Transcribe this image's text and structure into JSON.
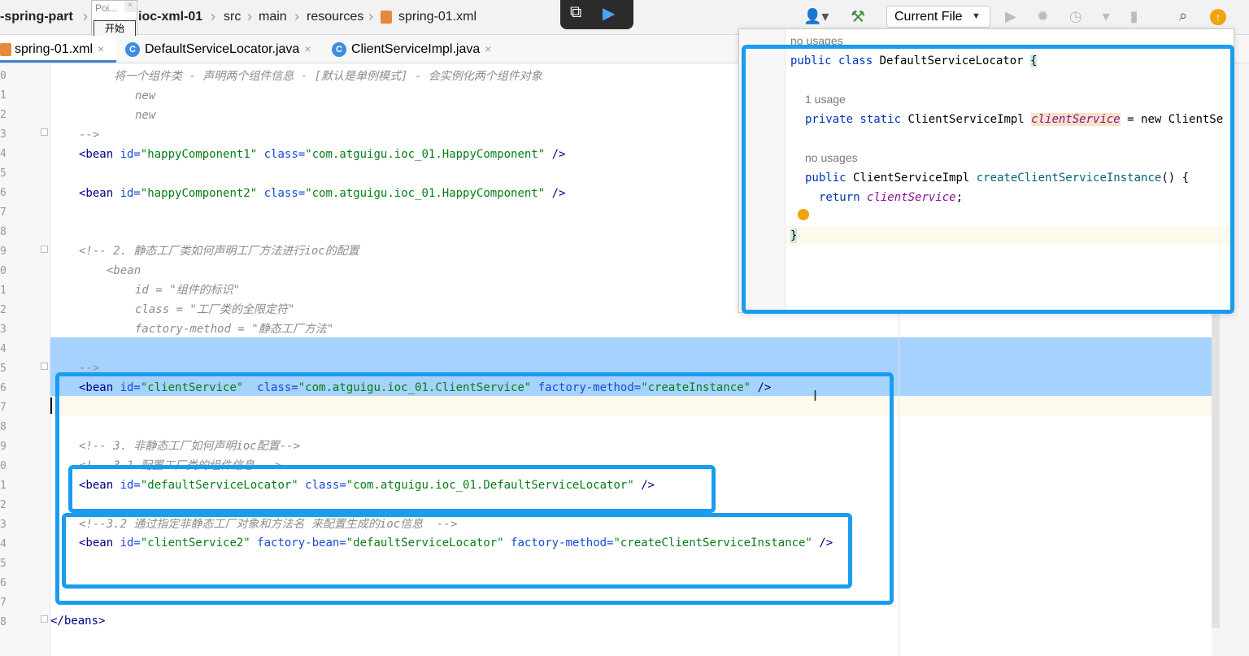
{
  "breadcrumb": [
    "-spring-part",
    "ioc-xml-01",
    "src",
    "main",
    "resources",
    "spring-01.xml"
  ],
  "popup": {
    "title": "Poi...",
    "button": "开始"
  },
  "toolbar": {
    "run_config": "Current File"
  },
  "tabs": [
    {
      "label": "spring-01.xml",
      "active": true
    },
    {
      "label": "DefaultServiceLocator.java",
      "active": false
    },
    {
      "label": "ClientServiceImpl.java",
      "active": false
    }
  ],
  "line_numbers": [
    "0",
    "1",
    "2",
    "3",
    "4",
    "5",
    "6",
    "7",
    "8",
    "9",
    "0",
    "1",
    "2",
    "3",
    "4",
    "5",
    "6",
    "7",
    "8",
    "9",
    "0",
    "1",
    "2",
    "3",
    "4",
    "5",
    "6",
    "7",
    "8"
  ],
  "code": {
    "l1": "将一个组件类 - 声明两个组件信息 - [默认是单例模式] - 会实例化两个组件对象",
    "l2": "new",
    "l3": "new",
    "l4": "-->",
    "b1_open": "<bean ",
    "b1_id_attr": "id=",
    "b1_id_val": "\"happyComponent1\"",
    "b1_class_attr": " class=",
    "b1_class_val": "\"com.atguigu.ioc_01.HappyComponent\"",
    "b1_close": " />",
    "b2_id_val": "\"happyComponent2\"",
    "c2": "<!-- 2. 静态工厂类如何声明工厂方法进行ioc的配置",
    "c2_bean": "<bean",
    "c2_id": "id = \"组件的标识\"",
    "c2_class": "class = \"工厂类的全限定符\"",
    "c2_fm": "factory-method = \"静态工厂方法\"",
    "c2_end": "-->",
    "b3_id_val": "\"clientService\"",
    "b3_class_val": "\"com.atguigu.ioc_01.ClientService\"",
    "b3_fm_attr": " factory-method=",
    "b3_fm_val": "\"createInstance\"",
    "c3": "<!-- 3. 非静态工厂如何声明ioc配置-->",
    "c3_1": "<!-- 3.1 配置工厂类的组件信息 -->",
    "b4_id_val": "\"defaultServiceLocator\"",
    "b4_class_val": "\"com.atguigu.ioc_01.DefaultServiceLocator\"",
    "c3_2": "<!--3.2 通过指定非静态工厂对象和方法名 来配置生成的ioc信息  -->",
    "b5_id_val": "\"clientService2\"",
    "b5_fb_attr": " factory-bean=",
    "b5_fb_val": "\"defaultServiceLocator\"",
    "b5_fm_val": "\"createClientServiceInstance\"",
    "end": "</beans>"
  },
  "quick_def": {
    "hint1": "no usages",
    "cls_kw": "public class ",
    "cls_name": "DefaultServiceLocator ",
    "cls_brace": "{",
    "hint2": "1 usage",
    "field_kw": "private static ",
    "field_type": "ClientServiceImpl ",
    "field_name": "clientService",
    "field_rest": " = new ClientSe",
    "hint3": "no usages",
    "m_kw": "public ",
    "m_type": "ClientServiceImpl ",
    "m_name": "createClientServiceInstance",
    "m_rest": "() {",
    "ret_kw": "return ",
    "ret_val": "clientService",
    "ret_end": ";",
    "close": "}"
  },
  "colors": {
    "highlight_box": "#1a9cf0",
    "selection": "#a6d2ff",
    "accent": "#4083c9"
  }
}
